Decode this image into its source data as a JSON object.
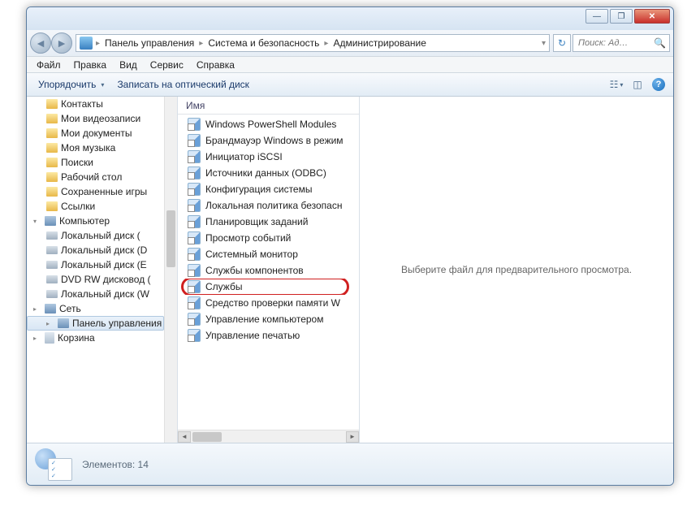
{
  "titlebar": {
    "minimize": "—",
    "maximize": "❐",
    "close": "✕"
  },
  "breadcrumb": {
    "items": [
      "Панель управления",
      "Система и безопасность",
      "Администрирование"
    ]
  },
  "search": {
    "placeholder": "Поиск: Ад…"
  },
  "menubar": {
    "items": [
      "Файл",
      "Правка",
      "Вид",
      "Сервис",
      "Справка"
    ]
  },
  "toolbar": {
    "organize": "Упорядочить",
    "burn": "Записать на оптический диск"
  },
  "tree": {
    "items": [
      {
        "label": "Контакты",
        "icon": "folder",
        "level": 2
      },
      {
        "label": "Мои видеозаписи",
        "icon": "folder",
        "level": 2
      },
      {
        "label": "Мои документы",
        "icon": "folder",
        "level": 2
      },
      {
        "label": "Моя музыка",
        "icon": "folder",
        "level": 2
      },
      {
        "label": "Поиски",
        "icon": "folder",
        "level": 2
      },
      {
        "label": "Рабочий стол",
        "icon": "folder",
        "level": 2
      },
      {
        "label": "Сохраненные игры",
        "icon": "folder",
        "level": 2
      },
      {
        "label": "Ссылки",
        "icon": "folder",
        "level": 2
      },
      {
        "label": "Компьютер",
        "icon": "comp",
        "level": 1,
        "expanded": true
      },
      {
        "label": "Локальный диск (",
        "icon": "drive",
        "level": 2
      },
      {
        "label": "Локальный диск (D",
        "icon": "drive",
        "level": 2
      },
      {
        "label": "Локальный диск (E",
        "icon": "drive",
        "level": 2
      },
      {
        "label": "DVD RW дисковод (",
        "icon": "drive",
        "level": 2
      },
      {
        "label": "Локальный диск (W",
        "icon": "drive",
        "level": 2
      },
      {
        "label": "Сеть",
        "icon": "comp",
        "level": 1
      },
      {
        "label": "Панель управления",
        "icon": "comp",
        "level": 1,
        "selected": true
      },
      {
        "label": "Корзина",
        "icon": "bin",
        "level": 1
      }
    ]
  },
  "filelist": {
    "header": "Имя",
    "items": [
      {
        "label": "Windows PowerShell Modules"
      },
      {
        "label": "Брандмауэр Windows в режим"
      },
      {
        "label": "Инициатор iSCSI"
      },
      {
        "label": "Источники данных (ODBC)"
      },
      {
        "label": "Конфигурация системы"
      },
      {
        "label": "Локальная политика безопасн"
      },
      {
        "label": "Планировщик заданий"
      },
      {
        "label": "Просмотр событий"
      },
      {
        "label": "Системный монитор"
      },
      {
        "label": "Службы компонентов"
      },
      {
        "label": "Службы",
        "highlighted": true
      },
      {
        "label": "Средство проверки памяти W"
      },
      {
        "label": "Управление компьютером"
      },
      {
        "label": "Управление печатью"
      }
    ]
  },
  "preview": {
    "text": "Выберите файл для предварительного просмотра."
  },
  "status": {
    "text": "Элементов: 14"
  }
}
